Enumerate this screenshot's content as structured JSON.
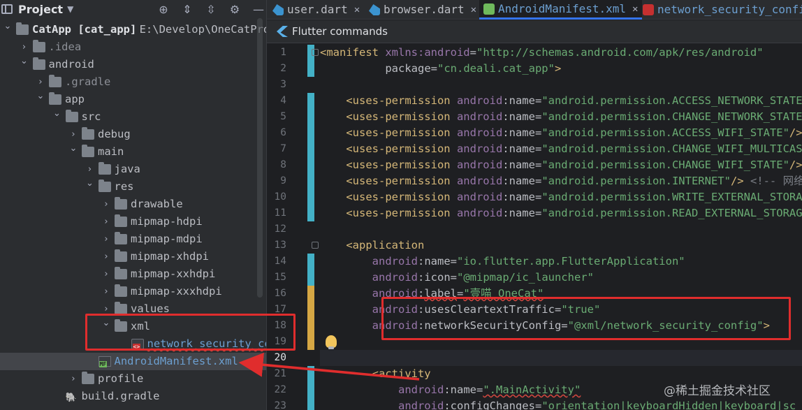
{
  "project_panel": {
    "title": "Project",
    "tools": [
      "target-icon",
      "expand-icon",
      "collapse-icon",
      "gear-icon",
      "hide-icon"
    ],
    "tree": [
      {
        "label": "CatApp [cat_app]",
        "suffix": " E:\\Develop\\OneCatPro",
        "kind": "module",
        "depth": 0,
        "expanded": true
      },
      {
        "label": ".idea",
        "kind": "folder",
        "depth": 1,
        "expanded": false
      },
      {
        "label": "android",
        "kind": "folder",
        "depth": 1,
        "expanded": true
      },
      {
        "label": ".gradle",
        "kind": "folder",
        "depth": 2,
        "expanded": false
      },
      {
        "label": "app",
        "kind": "folder",
        "depth": 2,
        "expanded": true
      },
      {
        "label": "src",
        "kind": "folder",
        "depth": 3,
        "expanded": true
      },
      {
        "label": "debug",
        "kind": "folder",
        "depth": 4,
        "expanded": false
      },
      {
        "label": "main",
        "kind": "folder",
        "depth": 4,
        "expanded": true
      },
      {
        "label": "java",
        "kind": "folder",
        "depth": 5,
        "expanded": false
      },
      {
        "label": "res",
        "kind": "folder",
        "depth": 5,
        "expanded": true
      },
      {
        "label": "drawable",
        "kind": "folder",
        "depth": 6,
        "expanded": false
      },
      {
        "label": "mipmap-hdpi",
        "kind": "folder",
        "depth": 6,
        "expanded": false
      },
      {
        "label": "mipmap-mdpi",
        "kind": "folder",
        "depth": 6,
        "expanded": false
      },
      {
        "label": "mipmap-xhdpi",
        "kind": "folder",
        "depth": 6,
        "expanded": false
      },
      {
        "label": "mipmap-xxhdpi",
        "kind": "folder",
        "depth": 6,
        "expanded": false
      },
      {
        "label": "mipmap-xxxhdpi",
        "kind": "folder",
        "depth": 6,
        "expanded": false
      },
      {
        "label": "values",
        "kind": "folder",
        "depth": 6,
        "expanded": false
      },
      {
        "label": "xml",
        "kind": "folder",
        "depth": 6,
        "expanded": true
      },
      {
        "label": "network_security_config.xml",
        "kind": "xml",
        "depth": 7
      },
      {
        "label": "AndroidManifest.xml",
        "kind": "manifest",
        "depth": 5,
        "selected": true
      },
      {
        "label": "profile",
        "kind": "folder",
        "depth": 4,
        "expanded": false
      },
      {
        "label": "build.gradle",
        "kind": "gradle",
        "depth": 3
      }
    ]
  },
  "editor": {
    "tabs": [
      {
        "label": "user.dart",
        "icon": "dart-icon",
        "closable": true,
        "active": false
      },
      {
        "label": "browser.dart",
        "icon": "dart-icon",
        "closable": true,
        "active": false
      },
      {
        "label": "AndroidManifest.xml",
        "icon": "manifest-icon",
        "closable": true,
        "active": true
      },
      {
        "label": "network_security_config",
        "icon": "xml-icon",
        "closable": false,
        "active": false
      }
    ],
    "flutter_bar": "Flutter commands",
    "current_line": 20,
    "lines": [
      {
        "no": 1,
        "indent": "",
        "parts": [
          [
            "tag",
            "<manifest "
          ],
          [
            "ns",
            "xmlns:android"
          ],
          [
            "punc",
            "="
          ],
          [
            "val",
            "\"http://schemas.android.com/apk/res/android\""
          ]
        ]
      },
      {
        "no": 2,
        "indent": "          ",
        "parts": [
          [
            "attr",
            "package"
          ],
          [
            "punc",
            "="
          ],
          [
            "val",
            "\"cn.deali.cat_app\""
          ],
          [
            "tag",
            ">"
          ]
        ]
      },
      {
        "no": 3,
        "indent": "",
        "parts": []
      },
      {
        "no": 4,
        "indent": "    ",
        "parts": [
          [
            "tag",
            "<uses-permission "
          ],
          [
            "ns",
            "android"
          ],
          [
            "punc",
            ":"
          ],
          [
            "attr",
            "name"
          ],
          [
            "punc",
            "="
          ],
          [
            "val",
            "\"android.permission.ACCESS_NETWORK_STATE\""
          ],
          [
            "tag",
            "/>"
          ]
        ]
      },
      {
        "no": 5,
        "indent": "    ",
        "parts": [
          [
            "tag",
            "<uses-permission "
          ],
          [
            "ns",
            "android"
          ],
          [
            "punc",
            ":"
          ],
          [
            "attr",
            "name"
          ],
          [
            "punc",
            "="
          ],
          [
            "val",
            "\"android.permission.CHANGE_NETWORK_STATE\""
          ],
          [
            "tag",
            "/>"
          ]
        ]
      },
      {
        "no": 6,
        "indent": "    ",
        "parts": [
          [
            "tag",
            "<uses-permission "
          ],
          [
            "ns",
            "android"
          ],
          [
            "punc",
            ":"
          ],
          [
            "attr",
            "name"
          ],
          [
            "punc",
            "="
          ],
          [
            "val",
            "\"android.permission.ACCESS_WIFI_STATE\""
          ],
          [
            "tag",
            "/>"
          ]
        ]
      },
      {
        "no": 7,
        "indent": "    ",
        "parts": [
          [
            "tag",
            "<uses-permission "
          ],
          [
            "ns",
            "android"
          ],
          [
            "punc",
            ":"
          ],
          [
            "attr",
            "name"
          ],
          [
            "punc",
            "="
          ],
          [
            "val",
            "\"android.permission.CHANGE_WIFI_MULTICAST_S"
          ]
        ]
      },
      {
        "no": 8,
        "indent": "    ",
        "parts": [
          [
            "tag",
            "<uses-permission "
          ],
          [
            "ns",
            "android"
          ],
          [
            "punc",
            ":"
          ],
          [
            "attr",
            "name"
          ],
          [
            "punc",
            "="
          ],
          [
            "val",
            "\"android.permission.CHANGE_WIFI_STATE\""
          ],
          [
            "tag",
            "/>"
          ]
        ]
      },
      {
        "no": 9,
        "indent": "    ",
        "parts": [
          [
            "tag",
            "<uses-permission "
          ],
          [
            "ns",
            "android"
          ],
          [
            "punc",
            ":"
          ],
          [
            "attr",
            "name"
          ],
          [
            "punc",
            "="
          ],
          [
            "val",
            "\"android.permission.INTERNET\""
          ],
          [
            "tag",
            "/>"
          ],
          [
            "cmt",
            " <!-- 网络通信"
          ]
        ]
      },
      {
        "no": 10,
        "indent": "    ",
        "parts": [
          [
            "tag",
            "<uses-permission "
          ],
          [
            "ns",
            "android"
          ],
          [
            "punc",
            ":"
          ],
          [
            "attr",
            "name"
          ],
          [
            "punc",
            "="
          ],
          [
            "val",
            "\"android.permission.WRITE_EXTERNAL_STORAGE\""
          ]
        ]
      },
      {
        "no": 11,
        "indent": "    ",
        "parts": [
          [
            "tag",
            "<uses-permission "
          ],
          [
            "ns",
            "android"
          ],
          [
            "punc",
            ":"
          ],
          [
            "attr",
            "name"
          ],
          [
            "punc",
            "="
          ],
          [
            "val",
            "\"android.permission.READ_EXTERNAL_STORAGE\""
          ],
          [
            "tag",
            "/>"
          ]
        ]
      },
      {
        "no": 12,
        "indent": "",
        "parts": []
      },
      {
        "no": 13,
        "indent": "    ",
        "parts": [
          [
            "tag",
            "<application"
          ]
        ]
      },
      {
        "no": 14,
        "indent": "        ",
        "parts": [
          [
            "ns",
            "android"
          ],
          [
            "punc",
            ":"
          ],
          [
            "attr",
            "name"
          ],
          [
            "punc",
            "="
          ],
          [
            "val",
            "\"io.flutter.app.FlutterApplication\""
          ]
        ]
      },
      {
        "no": 15,
        "indent": "        ",
        "parts": [
          [
            "ns",
            "android"
          ],
          [
            "punc",
            ":"
          ],
          [
            "attr",
            "icon"
          ],
          [
            "punc",
            "="
          ],
          [
            "val",
            "\"@mipmap/ic_launcher\""
          ]
        ]
      },
      {
        "no": 16,
        "indent": "        ",
        "parts": [
          [
            "ns",
            "android"
          ],
          [
            "punc",
            ":"
          ],
          [
            "attr",
            "label"
          ],
          [
            "punc",
            "="
          ],
          [
            "val",
            "\"壹喵 OneCat\""
          ]
        ]
      },
      {
        "no": 17,
        "indent": "        ",
        "parts": [
          [
            "ns",
            "android"
          ],
          [
            "punc",
            ":"
          ],
          [
            "attr",
            "usesCleartextTraffic"
          ],
          [
            "punc",
            "="
          ],
          [
            "val",
            "\"true\""
          ]
        ]
      },
      {
        "no": 18,
        "indent": "        ",
        "parts": [
          [
            "ns",
            "android"
          ],
          [
            "punc",
            ":"
          ],
          [
            "attr",
            "networkSecurityConfig"
          ],
          [
            "punc",
            "="
          ],
          [
            "val",
            "\"@xml/network_security_config\""
          ],
          [
            "tag",
            ">"
          ]
        ]
      },
      {
        "no": 19,
        "indent": "",
        "parts": []
      },
      {
        "no": 20,
        "indent": "",
        "parts": []
      },
      {
        "no": 21,
        "indent": "        ",
        "parts": [
          [
            "tag",
            "<activity"
          ]
        ]
      },
      {
        "no": 22,
        "indent": "            ",
        "parts": [
          [
            "ns",
            "android"
          ],
          [
            "punc",
            ":"
          ],
          [
            "attr",
            "name"
          ],
          [
            "punc",
            "="
          ],
          [
            "val",
            "\".MainActivity\""
          ]
        ]
      },
      {
        "no": 23,
        "indent": "            ",
        "parts": [
          [
            "ns",
            "android"
          ],
          [
            "punc",
            ":"
          ],
          [
            "attr",
            "configChanges"
          ],
          [
            "punc",
            "="
          ],
          [
            "val",
            "\"orientation|keyboardHidden|keyboard|sc"
          ]
        ]
      }
    ]
  },
  "watermark": "@稀土掘金技术社区",
  "colors": {
    "accent": "#3574f0",
    "annotation_red": "#e02d2d",
    "change_marker": "#43b1c7",
    "added_marker": "#d6a744"
  }
}
